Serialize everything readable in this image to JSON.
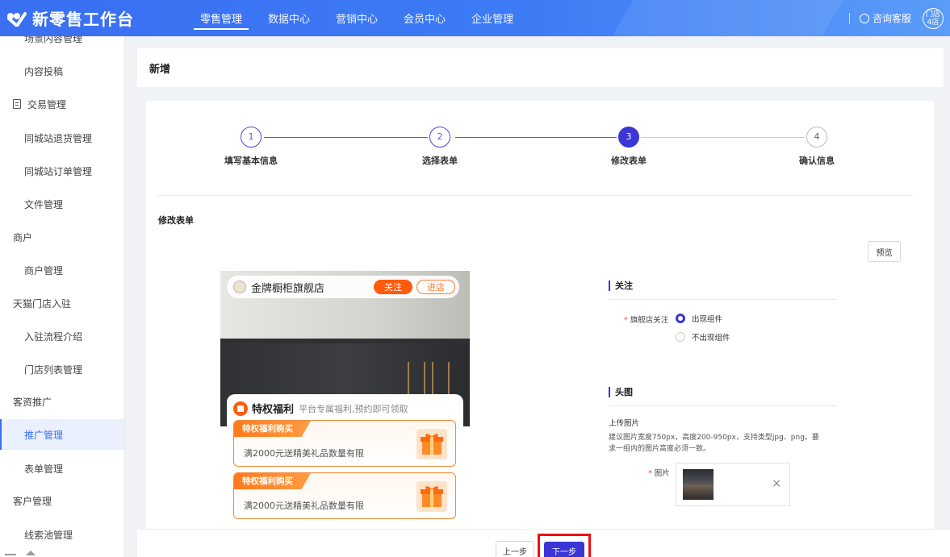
{
  "app": {
    "title": "新零售工作台"
  },
  "nav": {
    "items": [
      "零售管理",
      "数据中心",
      "营销中心",
      "会员中心",
      "企业管理"
    ],
    "active": "零售管理"
  },
  "topright": {
    "service_label": "咨询客服",
    "store_badge_line1": "门店",
    "store_badge_line2": "4店"
  },
  "sidebar": {
    "items": [
      {
        "label": "场景内容管理"
      },
      {
        "label": "内容投稿"
      },
      {
        "label": "交易管理"
      },
      {
        "label": "同城站退货管理"
      },
      {
        "label": "同城站订单管理"
      },
      {
        "label": "文件管理"
      },
      {
        "label": "商户"
      },
      {
        "label": "商户管理"
      },
      {
        "label": "天猫门店入驻"
      },
      {
        "label": "入驻流程介绍"
      },
      {
        "label": "门店列表管理"
      },
      {
        "label": "客资推广"
      },
      {
        "label": "推广管理"
      },
      {
        "label": "表单管理"
      },
      {
        "label": "客户管理"
      },
      {
        "label": "线索池管理"
      }
    ],
    "active": "推广管理"
  },
  "page": {
    "title": "新增",
    "section_title": "修改表单",
    "preview_label": "预览"
  },
  "steps": [
    {
      "num": "1",
      "label": "填写基本信息",
      "state": "done"
    },
    {
      "num": "2",
      "label": "选择表单",
      "state": "done"
    },
    {
      "num": "3",
      "label": "修改表单",
      "state": "current"
    },
    {
      "num": "4",
      "label": "确认信息",
      "state": "todo"
    }
  ],
  "phone": {
    "store_name": "金牌橱柜旗舰店",
    "follow_label": "关注",
    "enter_label": "进店",
    "welfare_title": "特权福利",
    "welfare_subtitle": "平台专属福利,预约即可领取",
    "coupons": [
      {
        "tag": "特权福利购买",
        "text": "满2000元送精美礼品数量有限"
      },
      {
        "tag": "特权福利购买",
        "text": "满2000元送精美礼品数量有限"
      }
    ]
  },
  "form": {
    "follow_section": "关注",
    "follow_field_label": "旗舰店关注",
    "radio_options": [
      "出现组件",
      "不出现组件"
    ],
    "radio_selected": "出现组件",
    "head_section": "头图",
    "upload_title": "上传图片",
    "upload_hint_line1": "建议图片宽度750px，高度200-950px，支持类型jpg、png。要",
    "upload_hint_line2": "求一组内的图片高度必须一致。",
    "image_label": "图片",
    "remove_symbol": "×"
  },
  "footer": {
    "prev_label": "上一步",
    "next_label": "下一步"
  },
  "colors": {
    "brand": "#3a6ff2",
    "step_accent": "#3b35d6",
    "orange": "#ff5a0e",
    "highlight_border": "#ee1111"
  }
}
